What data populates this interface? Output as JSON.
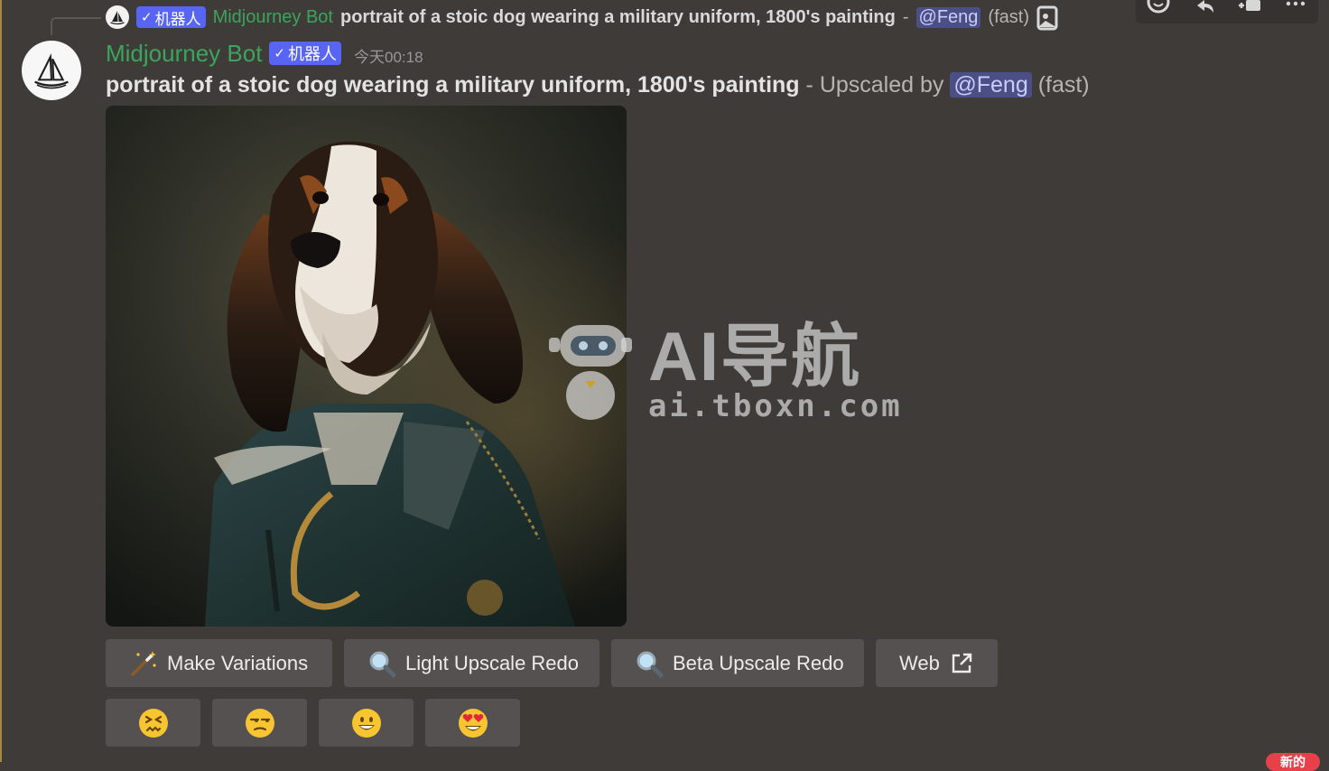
{
  "reply": {
    "bot_tag": "机器人",
    "author": "Midjourney Bot",
    "prompt": "portrait of a stoic dog wearing a military uniform, 1800's painting",
    "separator": "-",
    "mention": "@Feng",
    "mode": "(fast)"
  },
  "message": {
    "author": "Midjourney Bot",
    "bot_tag": "机器人",
    "timestamp": "今天00:18",
    "prompt": "portrait of a stoic dog wearing a military uniform, 1800's painting",
    "upscaled_text": "- Upscaled by",
    "mention": "@Feng",
    "mode": "(fast)"
  },
  "watermark": {
    "title": "AI导航",
    "domain": "ai.tboxn.com"
  },
  "buttons": {
    "make_variations": "Make Variations",
    "light_upscale_redo": "Light Upscale Redo",
    "beta_upscale_redo": "Beta Upscale Redo",
    "web": "Web"
  },
  "reactions": [
    "confounded-face",
    "unamused-face",
    "grinning-face",
    "heart-eyes-face"
  ],
  "badge": {
    "new": "新的"
  },
  "colors": {
    "background": "#3f3b39",
    "bot_name": "#3ba55c",
    "bot_tag": "#5865f2",
    "mention_bg": "#4b4f86",
    "button_bg": "#555150"
  }
}
